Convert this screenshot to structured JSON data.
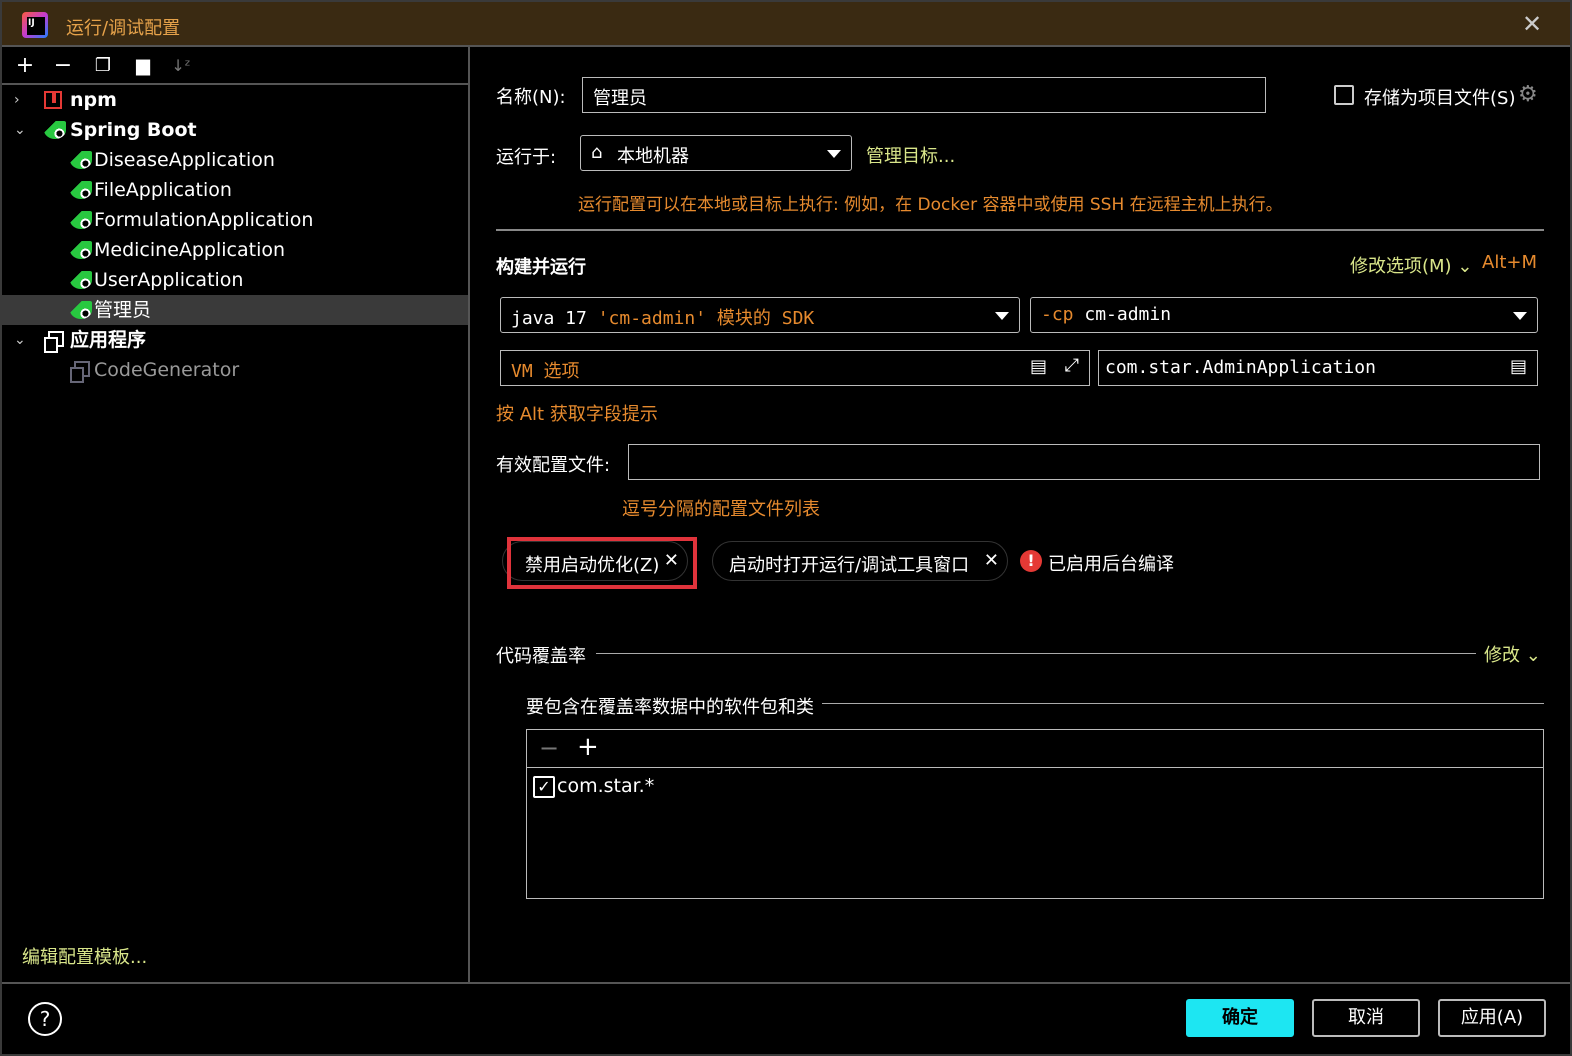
{
  "window": {
    "title": "运行/调试配置"
  },
  "tree": {
    "npm": "npm",
    "spring_boot": "Spring Boot",
    "apps": [
      "DiseaseApplication",
      "FileApplication",
      "FormulationApplication",
      "MedicineApplication",
      "UserApplication",
      "管理员"
    ],
    "application": "应用程序",
    "code_generator": "CodeGenerator"
  },
  "edit_templates": "编辑配置模板...",
  "config": {
    "name_label": "名称(N):",
    "name_value": "管理员",
    "store_as_project": "存储为项目文件(S)",
    "run_on_label": "运行于:",
    "run_on_value": "本地机器",
    "manage_targets": "管理目标...",
    "run_on_hint": "运行配置可以在本地或目标上执行: 例如，在 Docker 容器中或使用 SSH 在远程主机上执行。",
    "build_run_title": "构建并运行",
    "modify_options": "修改选项(M)",
    "modify_shortcut": "Alt+M",
    "sdk_java": "java 17",
    "sdk_module": "'cm-admin'",
    "sdk_suffix": "模块的 SDK",
    "cp_flag": "-cp",
    "cp_value": "cm-admin",
    "vm_placeholder": "VM 选项",
    "main_class": "com.star.AdminApplication",
    "alt_hint": "按 Alt 获取字段提示",
    "profiles_label": "有效配置文件:",
    "profiles_value": "",
    "profiles_hint": "逗号分隔的配置文件列表",
    "chip1": "禁用启动优化(Z)",
    "chip2": "启动时打开运行/调试工具窗口",
    "bg_compile": "已启用后台编译",
    "coverage_title": "代码覆盖率",
    "coverage_modify": "修改",
    "coverage_include": "要包含在覆盖率数据中的软件包和类",
    "coverage_items": [
      {
        "checked": true,
        "pattern": "com.star.*"
      }
    ]
  },
  "buttons": {
    "ok": "确定",
    "cancel": "取消",
    "apply": "应用(A)"
  },
  "colors": {
    "accent": "#1de6f2",
    "hint_orange": "#e68a2e",
    "link_yellow": "#d9e68a",
    "highlight_red": "#e0333b"
  }
}
